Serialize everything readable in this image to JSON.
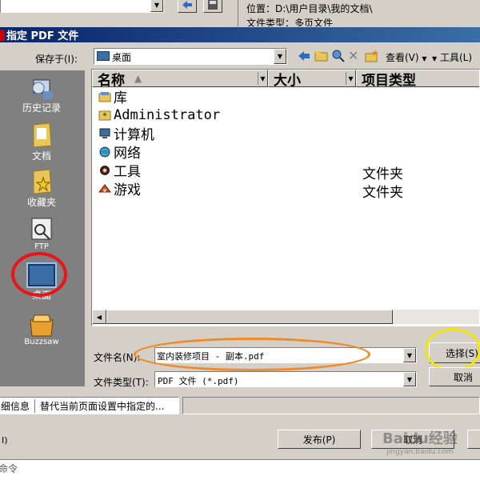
{
  "top": {
    "location_label": "位置：D:\\用户目录\\我的文档\\",
    "filetype_label": "文件类型：多页文件"
  },
  "dialog": {
    "title": "指定 PDF 文件",
    "save_in_label": "保存于(I):",
    "save_in_value": "桌面",
    "view_label": "查看(V)",
    "tools_label": "工具(L)",
    "filename_label": "文件名(N):",
    "filename_value": "室内装修项目 - 副本.pdf",
    "filetype_label": "文件类型(T):",
    "filetype_value": "PDF 文件 (*.pdf)",
    "select_button": "选择(S)",
    "cancel_button": "取消"
  },
  "sidebar": {
    "items": [
      {
        "label": "历史记录",
        "icon": "history-icon"
      },
      {
        "label": "文档",
        "icon": "documents-icon"
      },
      {
        "label": "收藏夹",
        "icon": "favorites-icon"
      },
      {
        "label": "FTP",
        "icon": "ftp-icon"
      },
      {
        "label": "桌面",
        "icon": "desktop-icon"
      },
      {
        "label": "Buzzsaw",
        "icon": "buzzsaw-icon"
      }
    ]
  },
  "columns": {
    "name": "名称",
    "size": "大小",
    "type": "项目类型"
  },
  "files": [
    {
      "name": "库",
      "type": "",
      "icon": "library-icon"
    },
    {
      "name": "Administrator",
      "type": "",
      "icon": "user-folder-icon"
    },
    {
      "name": "计算机",
      "type": "",
      "icon": "computer-icon"
    },
    {
      "name": "网络",
      "type": "",
      "icon": "network-icon"
    },
    {
      "name": "工具",
      "type": "文件夹",
      "icon": "tools-folder-icon"
    },
    {
      "name": "游戏",
      "type": "文件夹",
      "icon": "games-folder-icon"
    }
  ],
  "bottom": {
    "details_label": "细信息",
    "details_value": "替代当前页面设置中指定的...",
    "publish_button": "发布(P)",
    "cancel_button": "取消",
    "left_label": "I)",
    "cmd_label": "命令",
    "watermark": "Baidu经验",
    "watermark_sub": "jingyan.baidu.com"
  },
  "colors": {
    "titlebar": "#0a246a",
    "sidebar": "#808080",
    "red_circle": "#e8141b",
    "orange_ellipse": "#f08a2a",
    "yellow_circle": "#f4e40f"
  }
}
